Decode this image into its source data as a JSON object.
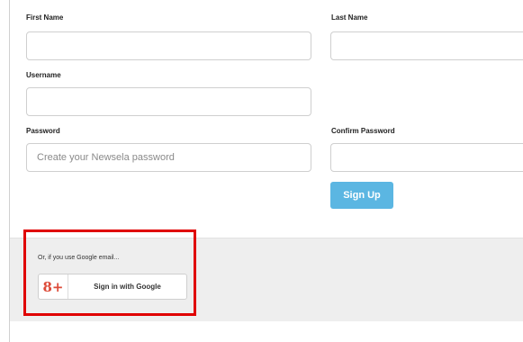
{
  "form": {
    "first_name_label": "First Name",
    "last_name_label": "Last Name",
    "username_label": "Username",
    "password_label": "Password",
    "confirm_password_label": "Confirm Password",
    "first_name_value": "",
    "last_name_value": "",
    "username_value": "",
    "password_placeholder": "Create your Newsela password",
    "confirm_password_value": "",
    "signup_label": "Sign Up"
  },
  "google": {
    "prompt": "Or, if you use Google email...",
    "button_label": "Sign in with Google",
    "icon": "google-plus-icon",
    "icon_glyph": "8+",
    "icon_color": "#dd4b39"
  },
  "colors": {
    "signup_button": "#5bb6e2",
    "highlight_border": "#e00000",
    "panel_background": "#eeeeee"
  }
}
